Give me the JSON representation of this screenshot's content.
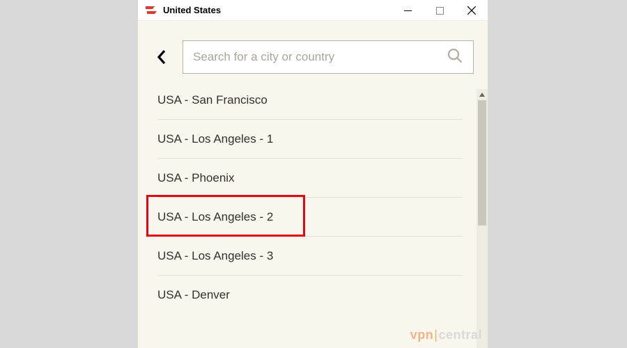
{
  "window": {
    "title": "United States"
  },
  "search": {
    "placeholder": "Search for a city or country",
    "value": ""
  },
  "locations": [
    "USA - San Francisco",
    "USA - Los Angeles - 1",
    "USA - Phoenix",
    "USA - Los Angeles - 2",
    "USA - Los Angeles - 3",
    "USA - Denver"
  ],
  "highlighted_index": 3,
  "watermark": {
    "left": "vpn",
    "right": "central"
  }
}
